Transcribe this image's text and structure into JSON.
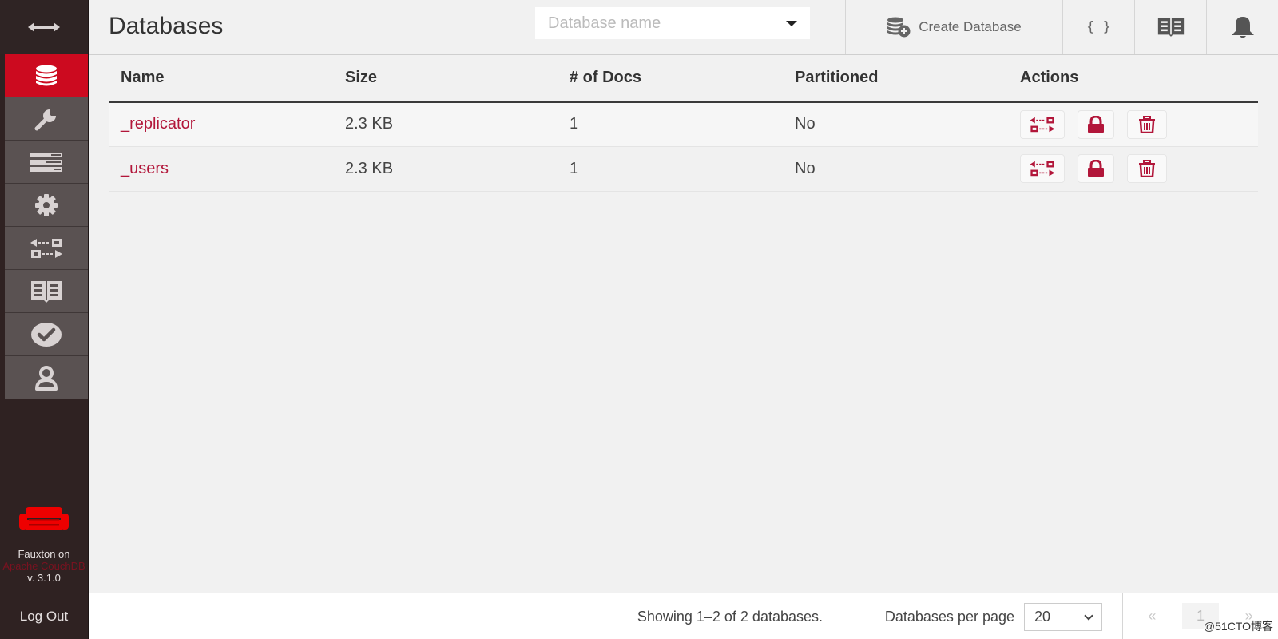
{
  "sidebar": {
    "items": [
      {
        "name": "databases",
        "active": true
      },
      {
        "name": "setup"
      },
      {
        "name": "active-tasks"
      },
      {
        "name": "configuration"
      },
      {
        "name": "replication"
      },
      {
        "name": "documentation"
      },
      {
        "name": "verify"
      },
      {
        "name": "user-management"
      }
    ],
    "brand_line1": "Fauxton on",
    "brand_line2": "Apache CouchDB",
    "version": "v. 3.1.0",
    "logout_label": "Log Out"
  },
  "header": {
    "title": "Databases",
    "search_placeholder": "Database name",
    "search_value": "",
    "create_label": "Create Database",
    "json_label": "{ }"
  },
  "table": {
    "columns": [
      "Name",
      "Size",
      "# of Docs",
      "Partitioned",
      "Actions"
    ],
    "rows": [
      {
        "name": "_replicator",
        "size": "2.3 KB",
        "docs": "1",
        "partitioned": "No"
      },
      {
        "name": "_users",
        "size": "2.3 KB",
        "docs": "1",
        "partitioned": "No"
      }
    ]
  },
  "footer": {
    "showing": "Showing 1–2 of 2 databases.",
    "per_page_label": "Databases per page",
    "per_page_value": "20",
    "prev": "«",
    "page": "1",
    "next": "»"
  },
  "watermark": "@51CTO博客",
  "colors": {
    "accent": "#cc0a1f",
    "link": "#b2163a",
    "sidebar_bg": "#2f2222",
    "sidebar_item_bg": "#5a5252"
  }
}
